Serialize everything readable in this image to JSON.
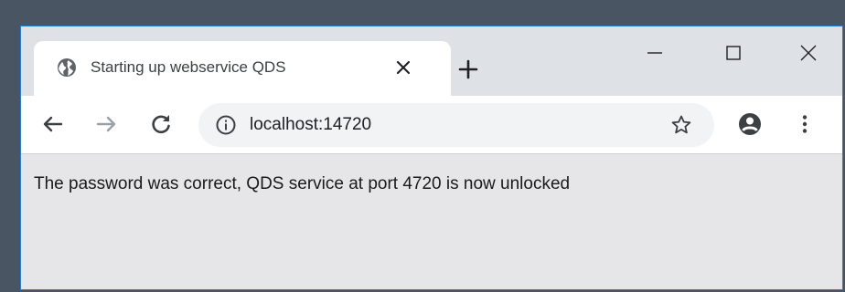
{
  "browser": {
    "tab": {
      "title": "Starting up webservice QDS",
      "favicon": "globe-icon"
    },
    "window_controls": [
      "minimize-icon",
      "maximize-icon",
      "close-icon"
    ],
    "toolbar": {
      "back": "back-arrow-icon",
      "forward": "forward-arrow-icon",
      "reload": "reload-icon",
      "address": "localhost:14720",
      "site_info": "info-icon",
      "bookmark": "star-icon",
      "profile": "profile-icon",
      "menu": "kebab-menu-icon"
    }
  },
  "page": {
    "message": "The password was correct, QDS service at port 4720 is now unlocked"
  },
  "colors": {
    "frame_accent": "#2a7fd4",
    "tab_strip": "#dee1e6",
    "page_background": "#e6e6e8"
  }
}
